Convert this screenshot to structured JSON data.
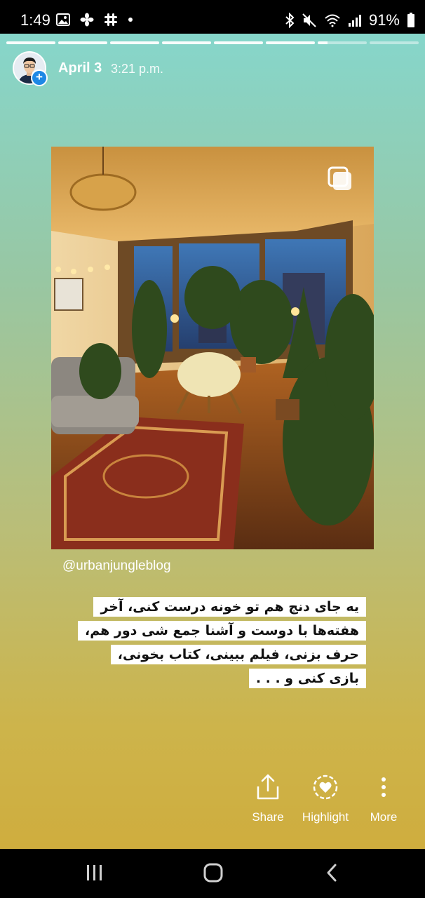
{
  "status_bar": {
    "time": "1:49",
    "battery": "91%",
    "left_icons": [
      "gallery-icon",
      "fan-icon",
      "slack-icon",
      "dot-icon"
    ],
    "right_icons": [
      "bluetooth-icon",
      "mute-icon",
      "wifi-icon",
      "signal-icon",
      "battery-icon"
    ]
  },
  "story": {
    "progress": {
      "total_segments": 8,
      "completed": 6,
      "current_fraction": 0.2
    },
    "date": "April 3",
    "time": "3:21 p.m.",
    "photo_alt_icon": "multi-photo-icon",
    "username_tag": "@urbanjungleblog",
    "caption_lines": [
      "یه جای دنج هم تو خونه درست کنی، آخر",
      "هفته‌ها با دوست و آشنا جمع شی دور هم،",
      "حرف بزنی، فیلم ببینی، کتاب بخونی،",
      "بازی کنی و . . ."
    ],
    "gradient_colors": [
      "#86d6cb",
      "#cfad3e"
    ]
  },
  "actions": [
    {
      "label": "Share",
      "icon": "share-icon"
    },
    {
      "label": "Highlight",
      "icon": "highlight-icon"
    },
    {
      "label": "More",
      "icon": "more-icon"
    }
  ],
  "nav_bar": {
    "buttons": [
      "recent-apps-icon",
      "home-icon",
      "back-icon"
    ]
  }
}
